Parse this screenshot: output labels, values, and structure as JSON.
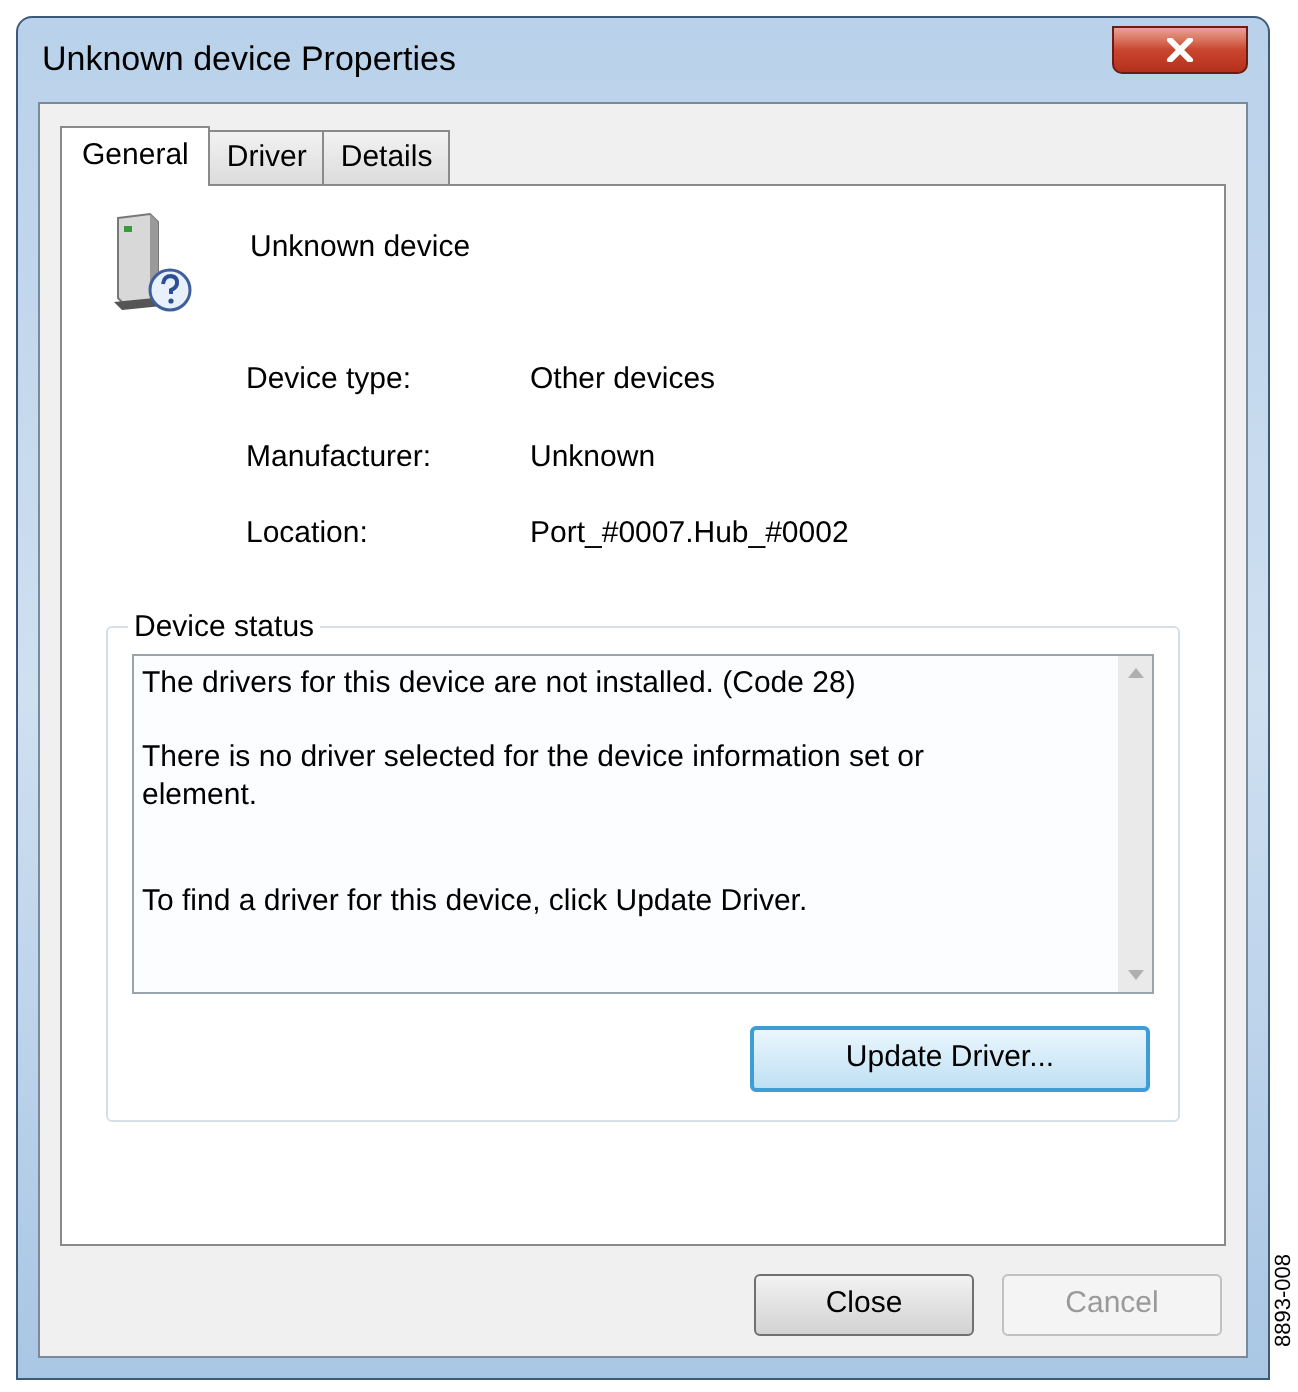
{
  "window": {
    "title": "Unknown device Properties"
  },
  "tabs": [
    {
      "label": "General",
      "selected": true
    },
    {
      "label": "Driver",
      "selected": false
    },
    {
      "label": "Details",
      "selected": false
    }
  ],
  "device": {
    "name": "Unknown device"
  },
  "properties": [
    {
      "label": "Device type:",
      "value": "Other devices"
    },
    {
      "label": "Manufacturer:",
      "value": "Unknown"
    },
    {
      "label": "Location:",
      "value": "Port_#0007.Hub_#0002"
    }
  ],
  "device_status": {
    "legend": "Device status",
    "paragraphs": [
      "The drivers for this device are not installed. (Code 28)",
      "There is no driver selected for the device information set or element.",
      "To find a driver for this device, click Update Driver."
    ],
    "button": {
      "label": "Update Driver...",
      "focused": true
    }
  },
  "buttons": [
    {
      "label": "Close",
      "disabled": false
    },
    {
      "label": "Cancel",
      "disabled": true
    }
  ],
  "figure_label": "8893-008"
}
